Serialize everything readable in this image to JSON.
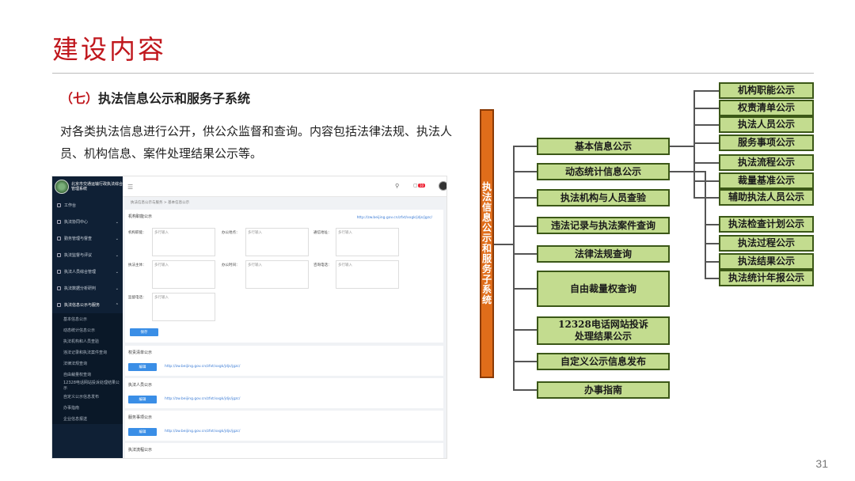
{
  "slide": {
    "title": "建设内容",
    "section_num": "（七）",
    "section_title": "执法信息公示和服务子系统",
    "description": "对各类执法信息进行公开，供公众监督和查询。内容包括法律法规、执法人员、机构信息、案件处理结果公示等。",
    "page_number": "31"
  },
  "app": {
    "system_name": "北京市交通运输行政执法综合管理系统",
    "nav": [
      {
        "label": "工作台"
      },
      {
        "label": "执法协同中心"
      },
      {
        "label": "勤务管理与督查"
      },
      {
        "label": "执法监督与评议"
      },
      {
        "label": "执法人员综合管理"
      },
      {
        "label": "执法数据分析研判"
      },
      {
        "label": "执法信息公示与服务"
      }
    ],
    "subnav": [
      "基本信息公示",
      "动态统计信息公示",
      "执法机构和人员查验",
      "违法记录和执法案件查询",
      "法律法规查询",
      "自由裁量权查询",
      "12328电话网站投诉处理结果公示",
      "自定义公示信息发布",
      "办事指南",
      "企业信息报送"
    ],
    "user": {
      "name": "admin",
      "role": "运维执法"
    },
    "notification_badge": "10",
    "breadcrumb": "执法信息公示与服务 > 基本信息公示",
    "card1": {
      "title": "机构职能公示",
      "link": "http://zw.beijing.gov.cn/zfxt/xxgk/jdjs/jgzc/",
      "fields": [
        {
          "label": "机构职能：",
          "placeholder": "多行输入"
        },
        {
          "label": "办公地点：",
          "placeholder": "多行输入"
        },
        {
          "label": "通信地址：",
          "placeholder": "多行输入"
        },
        {
          "label": "执法主体：",
          "placeholder": "多行输入"
        },
        {
          "label": "办公时间：",
          "placeholder": "多行输入"
        },
        {
          "label": "咨询电话：",
          "placeholder": "多行输入"
        },
        {
          "label": "监督电话：",
          "placeholder": "多行输入"
        }
      ],
      "save_label": "保存"
    },
    "link_cards": [
      {
        "title": "权责清单公示",
        "button": "编辑",
        "link": "http://zw.beijing.gov.cn/zfxt/xxgk/jdjs/jgzc/"
      },
      {
        "title": "执法人员公示",
        "button": "编辑",
        "link": "http://zw.beijing.gov.cn/zfxt/xxgk/jdjs/jgzc/"
      },
      {
        "title": "服务事项公示",
        "button": "编辑",
        "link": "http://zw.beijing.gov.cn/zfxt/xxgk/jdjs/jgzc/"
      },
      {
        "title": "执法流程公示"
      }
    ]
  },
  "diagram": {
    "root": "执法信息公示和服务子系统",
    "left": [
      "基本信息公示",
      "动态统计信息公示",
      "执法机构与人员查验",
      "违法记录与执法案件查询",
      "法律法规查询",
      "自由裁量权查询",
      "12328电话网站投诉处理结果公示",
      "自定义公示信息发布",
      "办事指南"
    ],
    "right_group1": [
      "机构职能公示",
      "权责清单公示",
      "执法人员公示",
      "服务事项公示",
      "执法流程公示",
      "裁量基准公示",
      "辅助执法人员公示"
    ],
    "right_group2": [
      "执法检查计划公示",
      "执法过程公示",
      "执法结果公示",
      "执法统计年报公示"
    ]
  }
}
